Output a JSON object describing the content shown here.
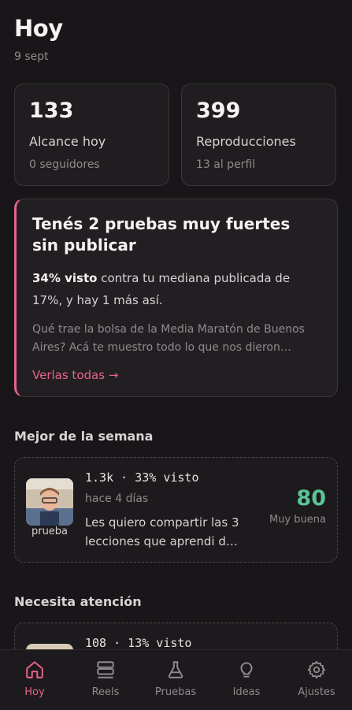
{
  "header": {
    "title": "Hoy",
    "date": "9 sept"
  },
  "stats": [
    {
      "value": "133",
      "label": "Alcance hoy",
      "sub": "0 seguidores"
    },
    {
      "value": "399",
      "label": "Reproducciones",
      "sub": "13 al perfil"
    }
  ],
  "alert": {
    "title": "Tenés 2 pruebas muy fuertes sin publicar",
    "highlight": "34% visto",
    "body_rest": " contra tu mediana publicada de 17%, y hay 1 más así.",
    "preview": "Qué trae la bolsa de la Media Maratón de Buenos Aires? Acá te muestro todo lo que nos dieron…",
    "link": "Verlas todas →",
    "accent": "#e8628f"
  },
  "best": {
    "section_title": "Mejor de la semana",
    "item": {
      "stats": "1.3k · 33% visto",
      "ago": "hace 4 días",
      "caption": "Les quiero compartir las 3 lecciones que aprendi d…",
      "thumb_label": "prueba",
      "score": "80",
      "score_label": "Muy buena",
      "score_color": "#58c497"
    }
  },
  "attention": {
    "section_title": "Necesita atención",
    "item": {
      "stats": "108 · 13% visto"
    }
  },
  "nav": {
    "items": [
      {
        "label": "Hoy",
        "icon": "home-icon",
        "active": true
      },
      {
        "label": "Reels",
        "icon": "stack-icon",
        "active": false
      },
      {
        "label": "Pruebas",
        "icon": "flask-icon",
        "active": false
      },
      {
        "label": "Ideas",
        "icon": "lightbulb-icon",
        "active": false
      },
      {
        "label": "Ajustes",
        "icon": "gear-icon",
        "active": false
      }
    ]
  }
}
